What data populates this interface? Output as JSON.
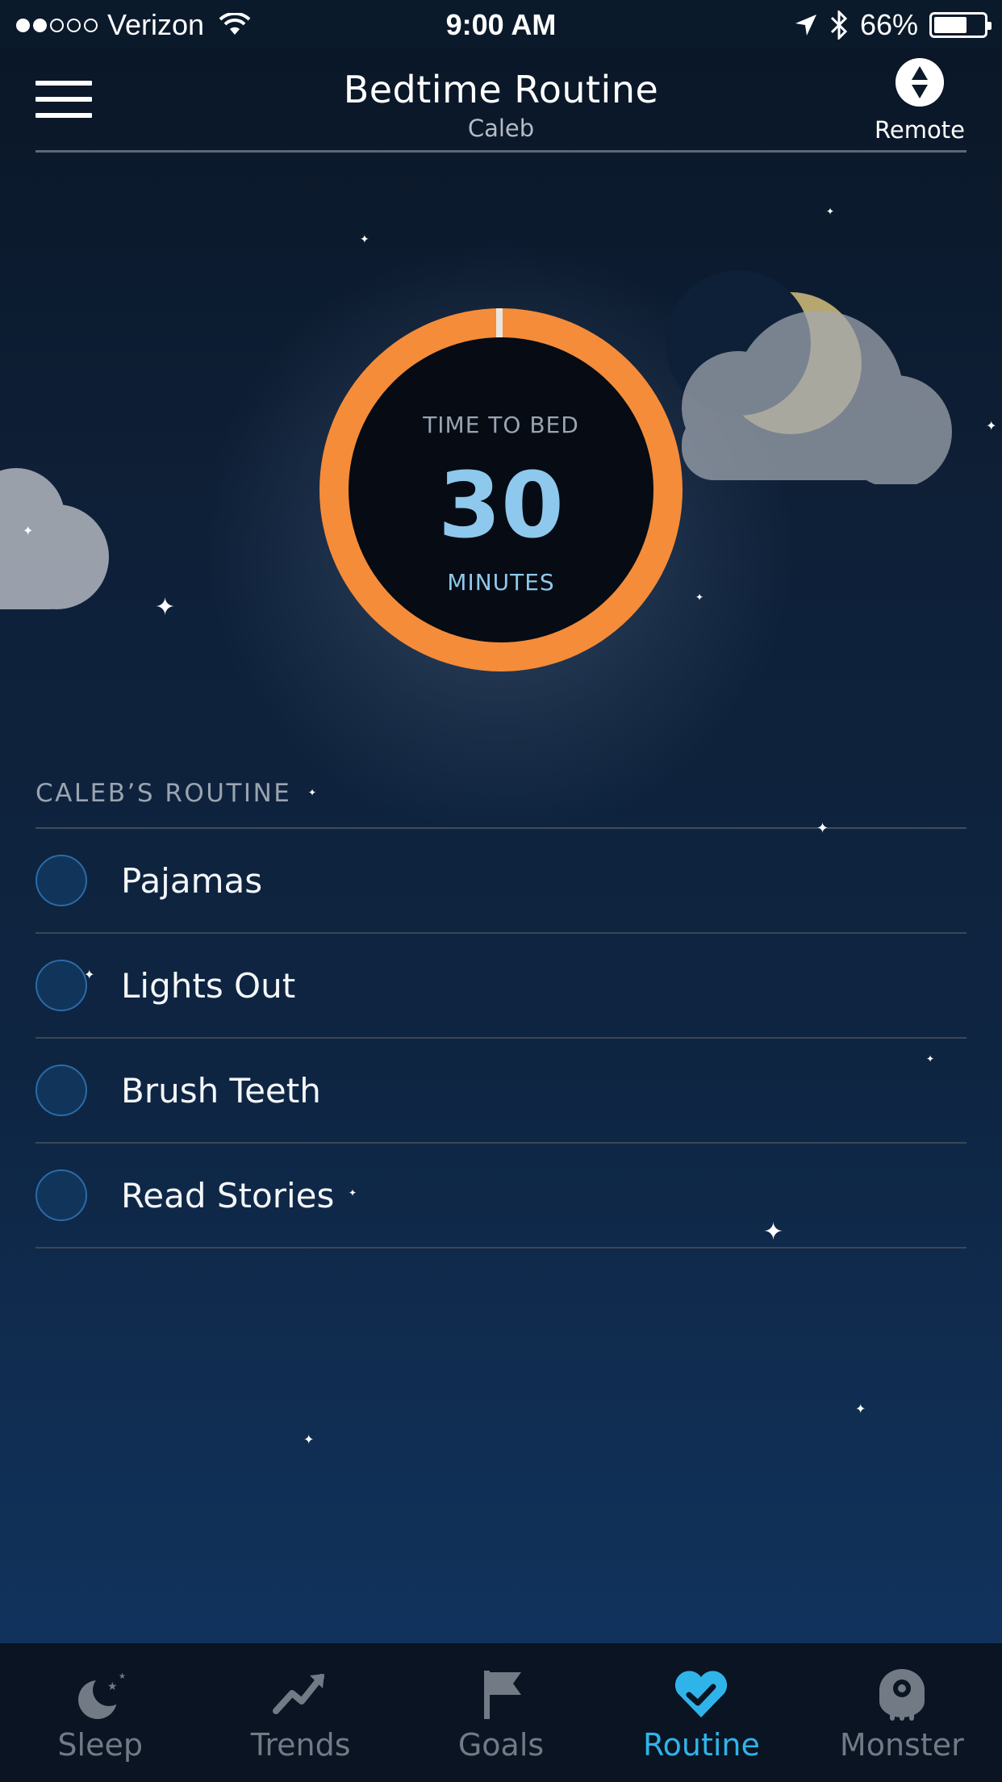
{
  "status_bar": {
    "carrier": "Verizon",
    "time": "9:00 AM",
    "battery": "66%",
    "battery_level": 0.66
  },
  "header": {
    "title": "Bedtime Routine",
    "subtitle": "Caleb",
    "remote_label": "Remote"
  },
  "timer": {
    "caption": "TIME TO BED",
    "value": "30",
    "unit": "MINUTES",
    "ring_color": "#f58c39",
    "value_color": "#8ec8ec"
  },
  "routine": {
    "heading": "CALEB’S ROUTINE",
    "items": [
      {
        "label": "Pajamas",
        "done": false
      },
      {
        "label": "Lights Out",
        "done": false
      },
      {
        "label": "Brush Teeth",
        "done": false
      },
      {
        "label": "Read Stories",
        "done": false
      }
    ]
  },
  "tabs": [
    {
      "label": "Sleep",
      "icon": "sleep-moon-icon",
      "active": false
    },
    {
      "label": "Trends",
      "icon": "trends-icon",
      "active": false
    },
    {
      "label": "Goals",
      "icon": "goals-flag-icon",
      "active": false
    },
    {
      "label": "Routine",
      "icon": "routine-heart-icon",
      "active": true
    },
    {
      "label": "Monster",
      "icon": "monster-icon",
      "active": false
    }
  ],
  "colors": {
    "accent": "#2fb4ea",
    "inactive_tab": "#717a85",
    "background_top": "#0a1626",
    "background_bottom": "#123663"
  }
}
